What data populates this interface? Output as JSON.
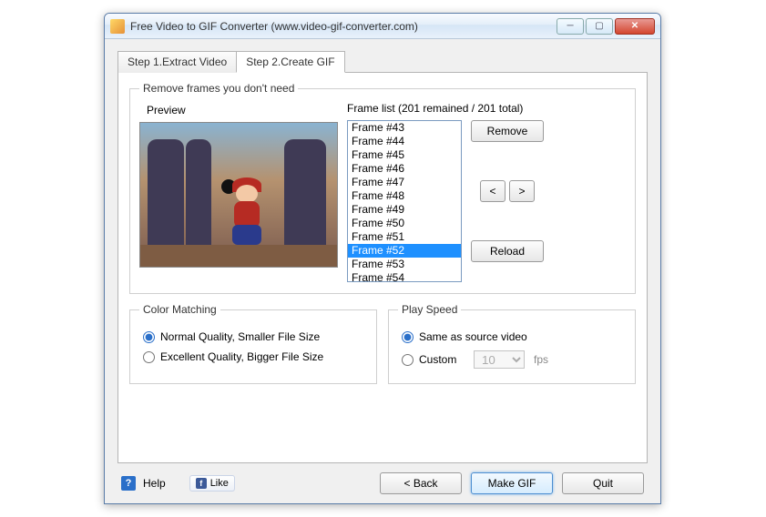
{
  "window": {
    "title": "Free Video to GIF Converter (www.video-gif-converter.com)"
  },
  "tabs": {
    "step1": "Step 1.Extract Video",
    "step2": "Step 2.Create GIF"
  },
  "frames_group": {
    "legend": "Remove frames you don't need",
    "preview_label": "Preview",
    "framelist_label": "Frame list (201 remained / 201 total)",
    "items": [
      "Frame #43",
      "Frame #44",
      "Frame #45",
      "Frame #46",
      "Frame #47",
      "Frame #48",
      "Frame #49",
      "Frame #50",
      "Frame #51",
      "Frame #52",
      "Frame #53",
      "Frame #54"
    ],
    "selected_index": 9,
    "remove_btn": "Remove",
    "prev_btn": "<",
    "next_btn": ">",
    "reload_btn": "Reload"
  },
  "color_group": {
    "legend": "Color Matching",
    "normal": "Normal Quality, Smaller File Size",
    "excellent": "Excellent Quality, Bigger File Size",
    "selected": "normal"
  },
  "speed_group": {
    "legend": "Play Speed",
    "same": "Same as source video",
    "custom": "Custom",
    "fps_value": "10",
    "fps_unit": "fps",
    "selected": "same"
  },
  "footer": {
    "help": "Help",
    "like": "Like",
    "back": "< Back",
    "make": "Make GIF",
    "quit": "Quit"
  }
}
